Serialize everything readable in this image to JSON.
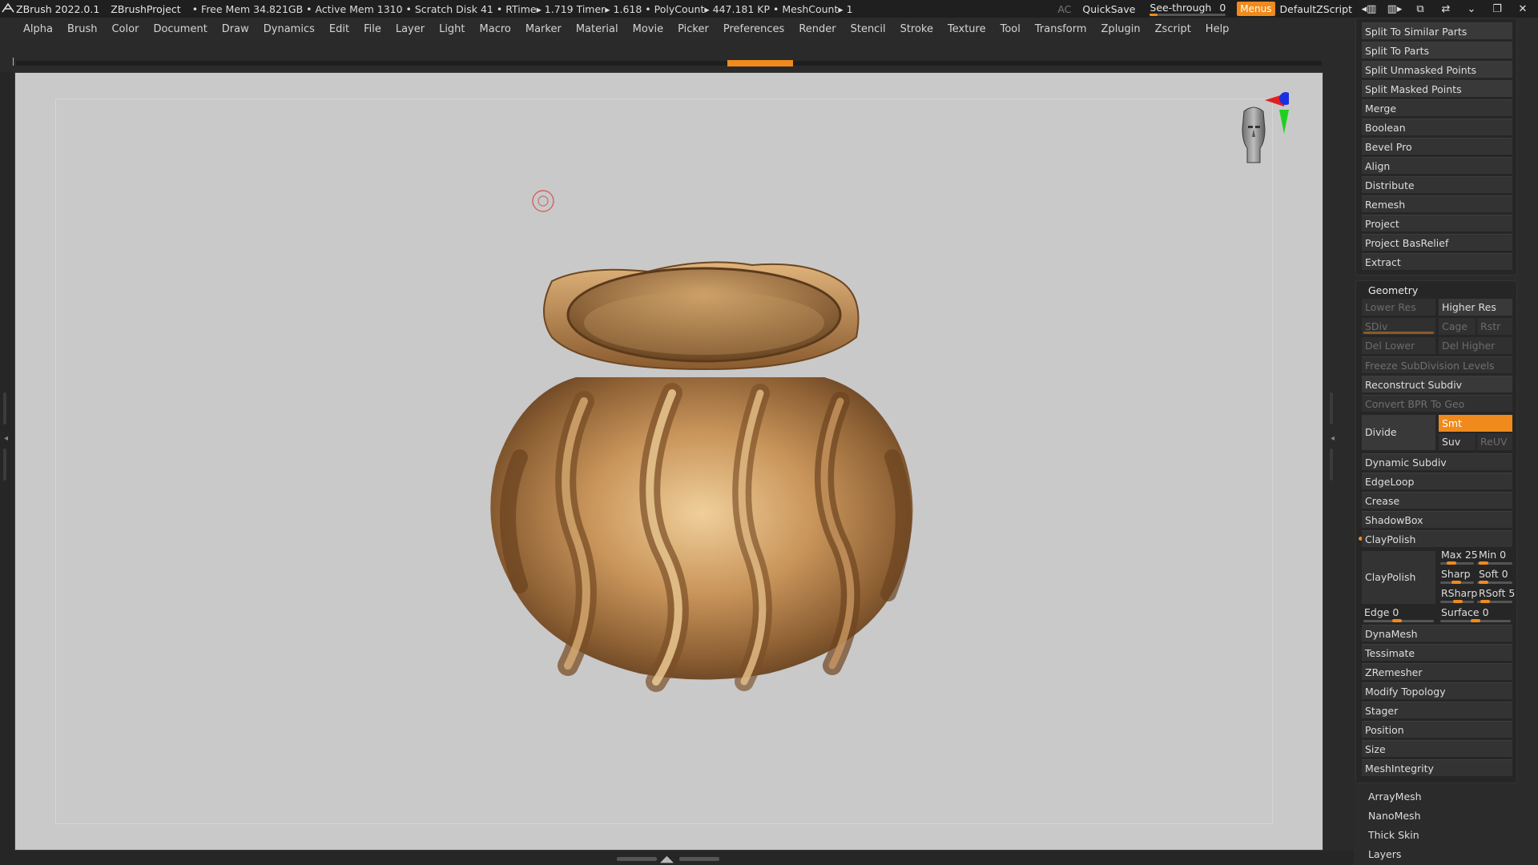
{
  "titlebar": {
    "app": "ZBrush 2022.0.1",
    "project": "ZBrushProject",
    "status": "• Free Mem 34.821GB • Active Mem 1310 • Scratch Disk 41 • RTime▸ 1.719 Timer▸ 1.618 • PolyCount▸ 447.181 KP • MeshCount▸ 1",
    "ac": "AC",
    "quicksave": "QuickSave",
    "see_through": "See-through",
    "see_through_value": "0",
    "menus": "Menus",
    "script": "DefaultZScript"
  },
  "menubar": {
    "items": [
      "Alpha",
      "Brush",
      "Color",
      "Document",
      "Draw",
      "Dynamics",
      "Edit",
      "File",
      "Layer",
      "Light",
      "Macro",
      "Marker",
      "Material",
      "Movie",
      "Picker",
      "Preferences",
      "Render",
      "Stencil",
      "Stroke",
      "Texture",
      "Tool",
      "Transform",
      "Zplugin",
      "Zscript",
      "Help"
    ]
  },
  "panel": {
    "subtool_buttons": [
      "Split To Similar Parts",
      "Split To Parts",
      "Split Unmasked Points",
      "Split Masked Points"
    ],
    "subtool_list": [
      "Merge",
      "Boolean",
      "Bevel Pro",
      "Align",
      "Distribute",
      "Remesh",
      "Project",
      "Project BasRelief",
      "Extract"
    ],
    "geometry": {
      "title": "Geometry",
      "lower_res": "Lower Res",
      "higher_res": "Higher Res",
      "sdiv": "SDiv",
      "cage": "Cage",
      "rstr": "Rstr",
      "del_lower": "Del Lower",
      "del_higher": "Del Higher",
      "freeze": "Freeze SubDivision Levels",
      "reconstruct": "Reconstruct Subdiv",
      "convert_bpr": "Convert BPR To Geo",
      "divide": "Divide",
      "smt": "Smt",
      "suv": "Suv",
      "reuv": "ReUV",
      "dynamic_subdiv": "Dynamic Subdiv",
      "edgeloop": "EdgeLoop",
      "crease": "Crease",
      "shadowbox": "ShadowBox",
      "claypolish_header": "ClayPolish",
      "claypolish_btn": "ClayPolish",
      "max": "Max 25",
      "min": "Min 0",
      "sharp": "Sharp",
      "soft": "Soft 0",
      "rsharp": "RSharp",
      "rsoft": "RSoft 5",
      "edge": "Edge 0",
      "surface": "Surface 0",
      "after": [
        "DynaMesh",
        "Tessimate",
        "ZRemesher",
        "Modify Topology",
        "Stager",
        "Position",
        "Size",
        "MeshIntegrity"
      ]
    },
    "bottom": [
      "ArrayMesh",
      "NanoMesh",
      "Thick Skin",
      "Layers"
    ]
  },
  "colors": {
    "accent": "#f08a1c",
    "viewport_bg": "#c9c9c9",
    "bronze": "#b8864e"
  }
}
